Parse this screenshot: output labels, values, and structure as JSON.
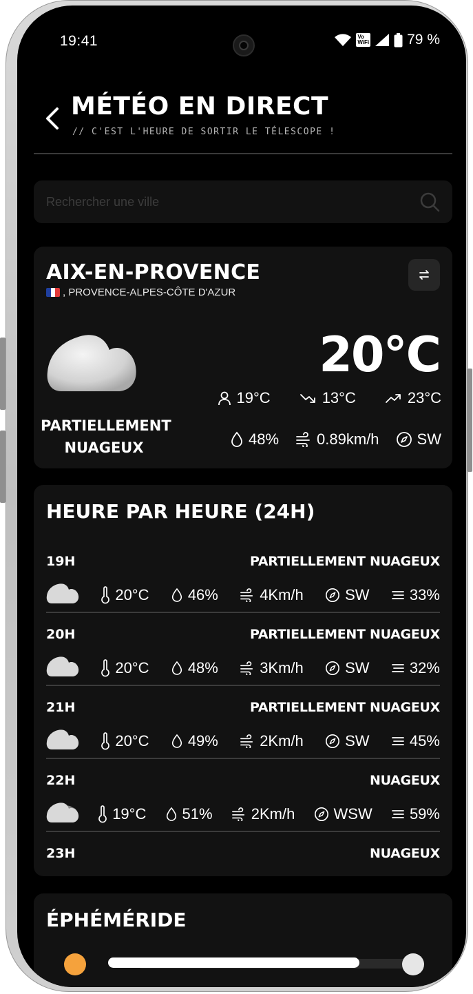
{
  "status_bar": {
    "time": "19:41",
    "volte_label": "Vo\nWiFi",
    "battery": "79 %"
  },
  "header": {
    "title": "MÉTÉO EN DIRECT",
    "subtitle": "// C'EST L'HEURE DE SORTIR LE TÉLESCOPE !"
  },
  "search": {
    "placeholder": "Rechercher une ville",
    "value": ""
  },
  "current": {
    "city": "AIX-EN-PROVENCE",
    "region": ", PROVENCE-ALPES-CÔTE D'AZUR",
    "temperature": "20°C",
    "condition_line1": "PARTIELLEMENT",
    "condition_line2": "NUAGEUX",
    "feels_like": "19°C",
    "min": "13°C",
    "max": "23°C",
    "humidity": "48%",
    "wind_speed": "0.89km/h",
    "wind_dir": "SW"
  },
  "hourly": {
    "title": "HEURE PAR HEURE (24H)",
    "rows": [
      {
        "hour": "19H",
        "condition": "PARTIELLEMENT NUAGEUX",
        "temp": "20°C",
        "humidity": "46%",
        "wind": "4Km/h",
        "dir": "SW",
        "clouds": "33%",
        "icon": "partly-cloudy"
      },
      {
        "hour": "20H",
        "condition": "PARTIELLEMENT NUAGEUX",
        "temp": "20°C",
        "humidity": "48%",
        "wind": "3Km/h",
        "dir": "SW",
        "clouds": "32%",
        "icon": "partly-cloudy"
      },
      {
        "hour": "21H",
        "condition": "PARTIELLEMENT NUAGEUX",
        "temp": "20°C",
        "humidity": "49%",
        "wind": "2Km/h",
        "dir": "SW",
        "clouds": "45%",
        "icon": "partly-cloudy"
      },
      {
        "hour": "22H",
        "condition": "NUAGEUX",
        "temp": "19°C",
        "humidity": "51%",
        "wind": "2Km/h",
        "dir": "WSW",
        "clouds": "59%",
        "icon": "cloudy"
      },
      {
        "hour": "23H",
        "condition": "NUAGEUX"
      }
    ]
  },
  "ephemeride": {
    "title": "ÉPHÉMÉRIDE"
  },
  "colors": {
    "background": "#000000",
    "card": "#121212",
    "sun": "#f5a23c",
    "flag_blue": "#1f3f9f",
    "flag_red": "#e23a3a"
  }
}
